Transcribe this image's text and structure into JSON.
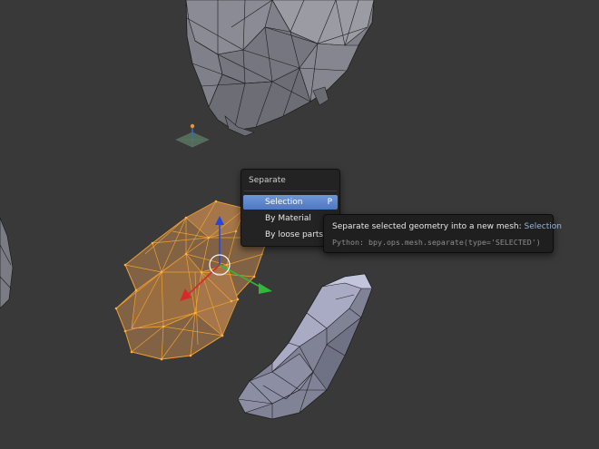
{
  "viewport": {
    "background_color": "#393939"
  },
  "scene": {
    "objects": [
      {
        "name": "top-rock-mesh",
        "state": "unselected",
        "color": "#8e8e96"
      },
      {
        "name": "selected-mesh",
        "state": "selected-edit",
        "color": "#e8952e"
      },
      {
        "name": "right-slab-mesh",
        "state": "unselected",
        "color": "#8e90a8"
      },
      {
        "name": "left-edge-mesh",
        "state": "unselected",
        "color": "#8e8e96"
      },
      {
        "name": "lamp",
        "state": "unselected"
      }
    ],
    "gizmo": {
      "x_axis_color": "#d42a2a",
      "y_axis_color": "#2fb83a",
      "z_axis_color": "#2646e0"
    }
  },
  "menu": {
    "title": "Separate",
    "items": [
      {
        "label": "Selection",
        "shortcut": "P",
        "active": true
      },
      {
        "label": "By Material",
        "shortcut": "",
        "active": false
      },
      {
        "label": "By loose parts",
        "shortcut": "",
        "active": false
      }
    ],
    "active_color": "#5680cc"
  },
  "tooltip": {
    "description": "Separate selected geometry into a new mesh:",
    "value": "Selection",
    "python": "Python: bpy.ops.mesh.separate(type='SELECTED')"
  }
}
